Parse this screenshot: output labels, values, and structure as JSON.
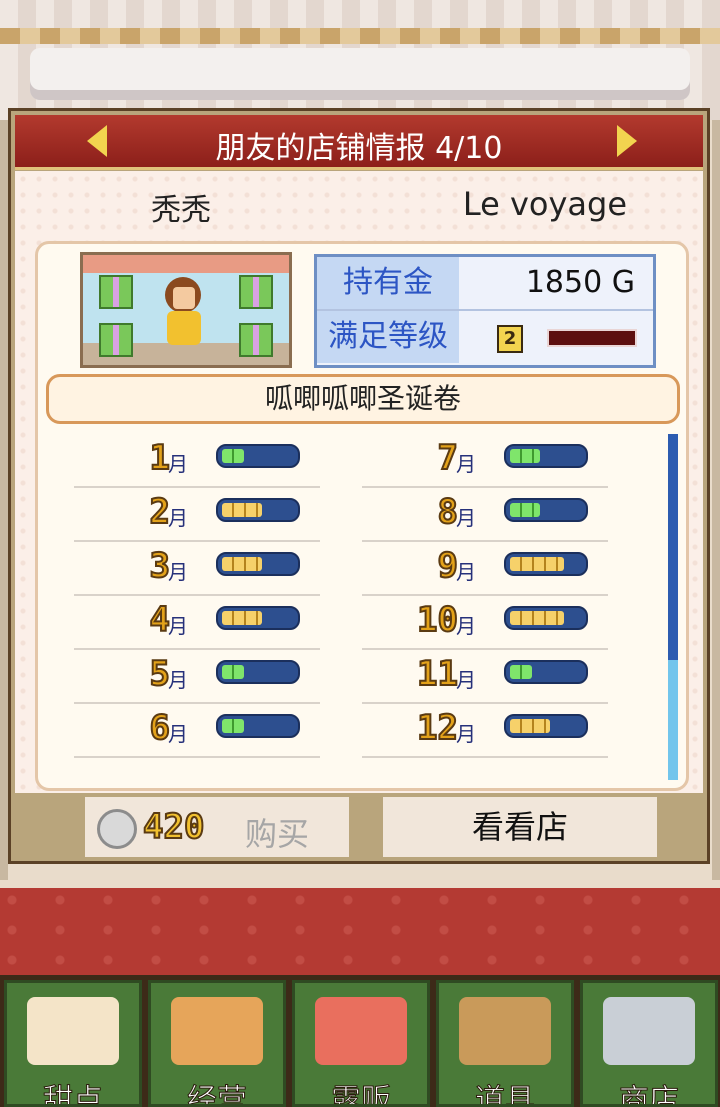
{
  "header": {
    "title": "朋友的店铺情报 4/10"
  },
  "friend": {
    "owner": "秃秃",
    "shop": "Le voyage"
  },
  "stats": {
    "money_label": "持有金",
    "money_value": "1850",
    "money_unit": "G",
    "satisfaction_label": "满足等级",
    "satisfaction_level": "2"
  },
  "item": {
    "name": "呱唧呱唧圣诞卷"
  },
  "months": {
    "unit": "月",
    "left": [
      {
        "num": "1",
        "fill": 0.3,
        "color": "green"
      },
      {
        "num": "2",
        "fill": 0.55,
        "color": "gold"
      },
      {
        "num": "3",
        "fill": 0.55,
        "color": "gold"
      },
      {
        "num": "4",
        "fill": 0.55,
        "color": "gold"
      },
      {
        "num": "5",
        "fill": 0.3,
        "color": "green"
      },
      {
        "num": "6",
        "fill": 0.3,
        "color": "green"
      }
    ],
    "right": [
      {
        "num": "7",
        "fill": 0.42,
        "color": "green"
      },
      {
        "num": "8",
        "fill": 0.42,
        "color": "green"
      },
      {
        "num": "9",
        "fill": 0.75,
        "color": "gold"
      },
      {
        "num": "10",
        "fill": 0.75,
        "color": "gold"
      },
      {
        "num": "11",
        "fill": 0.3,
        "color": "green"
      },
      {
        "num": "12",
        "fill": 0.55,
        "color": "gold"
      }
    ]
  },
  "actions": {
    "price": "420",
    "buy_label": "购买",
    "view_label": "看看店"
  },
  "bottom_nav": [
    {
      "label": "甜点",
      "icon": "cake-icon",
      "color": "#f4e4c8"
    },
    {
      "label": "经营",
      "icon": "store-icon",
      "color": "#e6a55a"
    },
    {
      "label": "露贩",
      "icon": "food-truck-icon",
      "color": "#e96f5e"
    },
    {
      "label": "道具",
      "icon": "items-bag-icon",
      "color": "#c99a5a"
    },
    {
      "label": "商店",
      "icon": "shopping-cart-icon",
      "color": "#c9cfd6"
    }
  ]
}
